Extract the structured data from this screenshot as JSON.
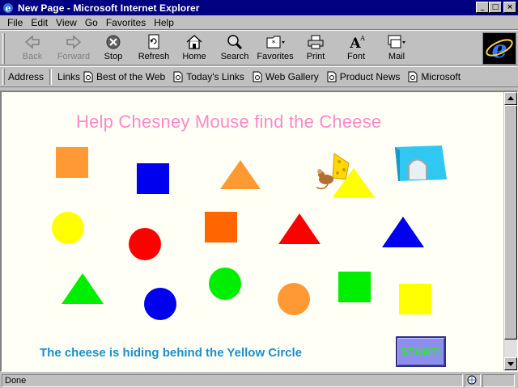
{
  "window": {
    "title": "New Page - Microsoft Internet Explorer",
    "controls": {
      "minimize": "_",
      "maximize": "□",
      "close": "×"
    }
  },
  "menubar": {
    "items": [
      "File",
      "Edit",
      "View",
      "Go",
      "Favorites",
      "Help"
    ]
  },
  "toolbar": {
    "buttons": [
      {
        "label": "Back",
        "icon": "back-arrow-icon",
        "enabled": false
      },
      {
        "label": "Forward",
        "icon": "forward-arrow-icon",
        "enabled": false
      },
      {
        "label": "Stop",
        "icon": "stop-icon",
        "enabled": true
      },
      {
        "label": "Refresh",
        "icon": "refresh-icon",
        "enabled": true
      },
      {
        "label": "Home",
        "icon": "home-icon",
        "enabled": true
      },
      {
        "label": "Search",
        "icon": "search-icon",
        "enabled": true
      },
      {
        "label": "Favorites",
        "icon": "favorites-icon",
        "enabled": true
      },
      {
        "label": "Print",
        "icon": "print-icon",
        "enabled": true
      },
      {
        "label": "Font",
        "icon": "font-icon",
        "enabled": true
      },
      {
        "label": "Mail",
        "icon": "mail-icon",
        "enabled": true
      }
    ]
  },
  "linksbar": {
    "address_label": "Address",
    "links_label": "Links",
    "links": [
      "Best of the Web",
      "Today's Links",
      "Web Gallery",
      "Product News",
      "Microsoft"
    ]
  },
  "page": {
    "heading": "Help Chesney Mouse find the Cheese",
    "hint": "The cheese is hiding behind the Yellow Circle",
    "start_label": "START!",
    "colors": {
      "orange": "#ff9933",
      "dark_orange": "#ff6600",
      "blue": "#0000ee",
      "yellow": "#ffff00",
      "red": "#ff0000",
      "green": "#00ee00",
      "heading": "#ff88c8",
      "hint": "#1a8fc8"
    }
  },
  "statusbar": {
    "text": "Done"
  }
}
